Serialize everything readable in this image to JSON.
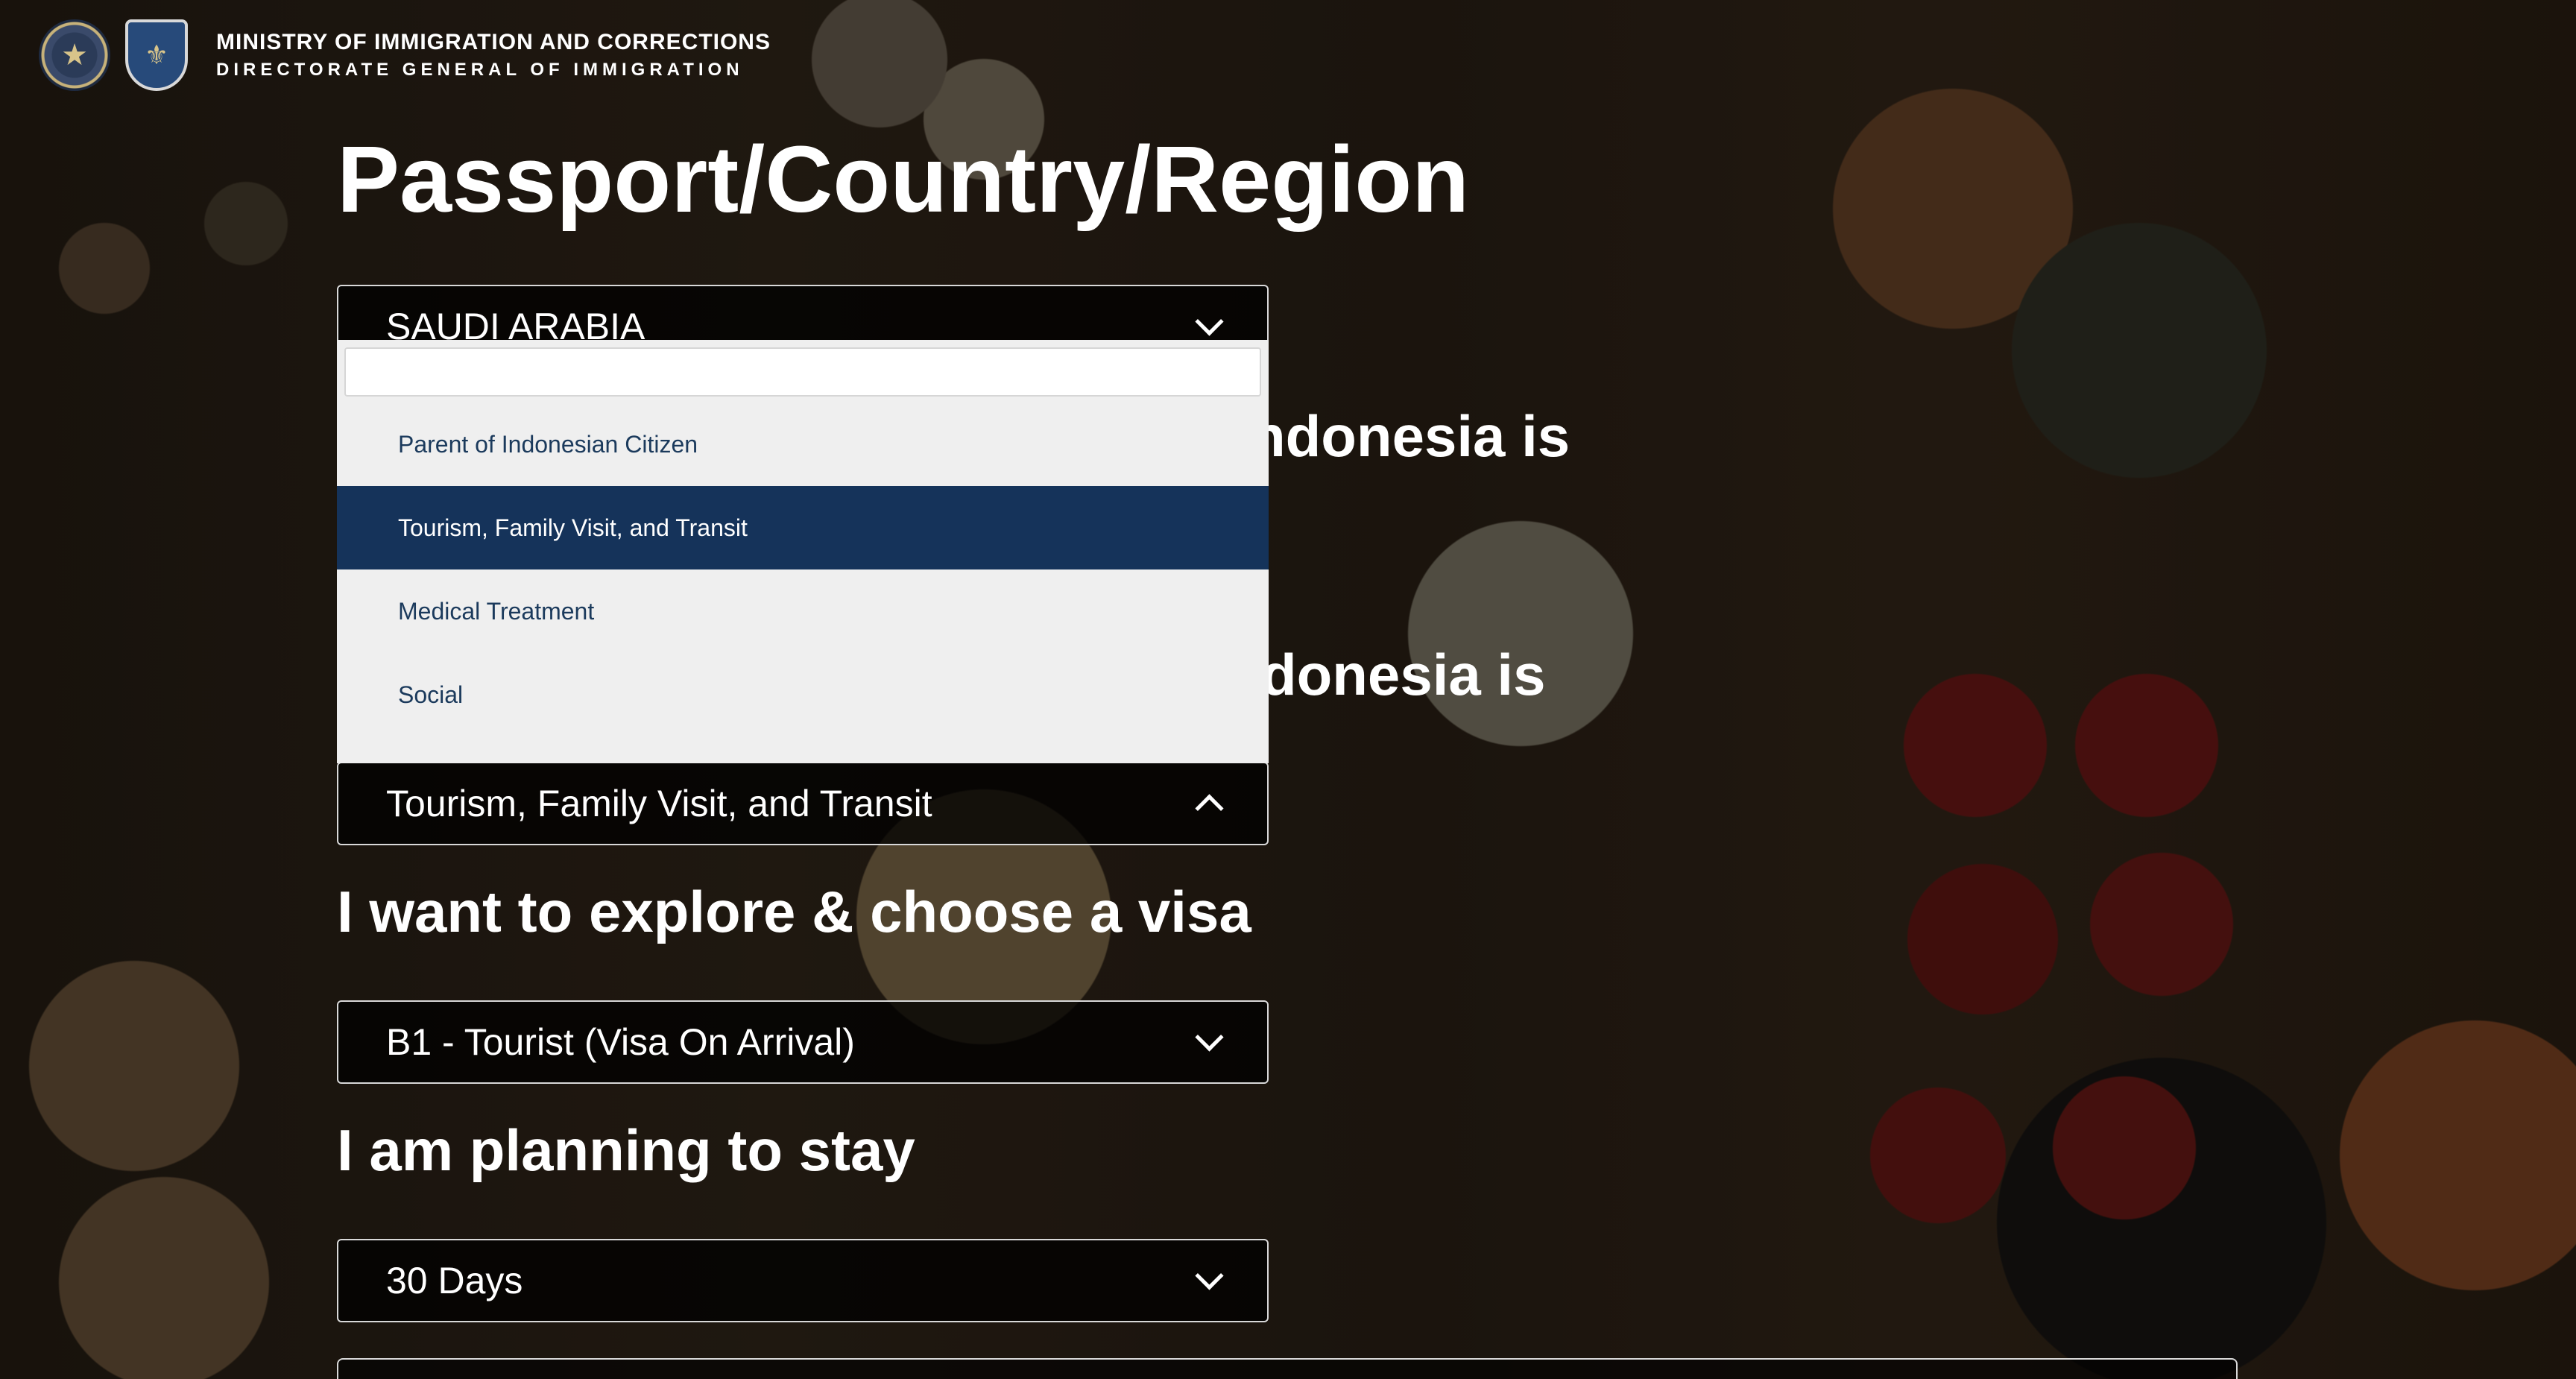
{
  "header": {
    "ministry": "MINISTRY OF IMMIGRATION AND CORRECTIONS",
    "directorate": "DIRECTORATE GENERAL OF IMMIGRATION"
  },
  "page_title": "Passport/Country/Region",
  "passport_select": {
    "value": "SAUDI ARABIA"
  },
  "question_1_suffix": "ndonesia is",
  "question_2_suffix": "donesia is",
  "purpose_dropdown": {
    "search_value": "",
    "options": [
      "Parent of Indonesian Citizen",
      "Tourism, Family Visit, and Transit",
      "Medical Treatment",
      "Social"
    ],
    "selected_index": 1
  },
  "purpose_select": {
    "value": "Tourism, Family Visit, and Transit"
  },
  "visa_question": "I want to explore & choose a visa",
  "visa_select": {
    "value": "B1 - Tourist (Visa On Arrival)"
  },
  "stay_question": "I am planning to stay",
  "stay_select": {
    "value": "30 Days"
  }
}
